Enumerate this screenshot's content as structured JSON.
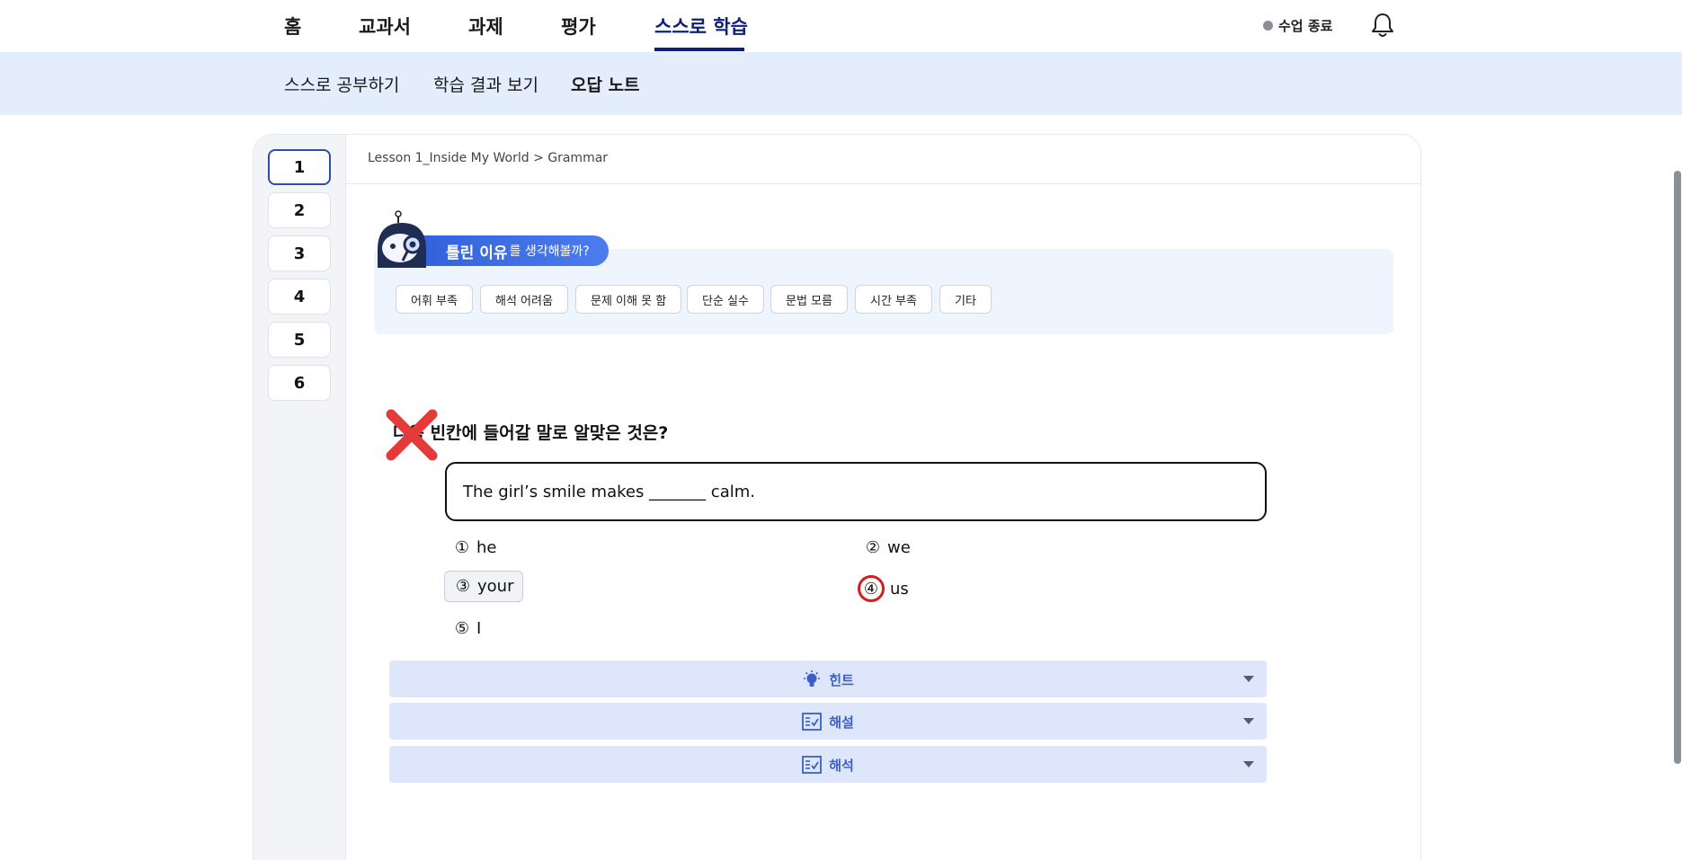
{
  "topnav": {
    "tabs": [
      {
        "label": "홈"
      },
      {
        "label": "교과서"
      },
      {
        "label": "과제"
      },
      {
        "label": "평가"
      },
      {
        "label": "스스로 학습",
        "active": true
      }
    ],
    "end_class_label": "수업 종료",
    "bell_icon": "bell-icon"
  },
  "subnav": {
    "items": [
      {
        "label": "스스로 공부하기"
      },
      {
        "label": "학습 결과 보기"
      },
      {
        "label": "오답 노트",
        "active": true
      }
    ]
  },
  "question_numbers": [
    "1",
    "2",
    "3",
    "4",
    "5",
    "6"
  ],
  "active_question": "1",
  "breadcrumb": "Lesson 1_Inside My World > Grammar",
  "wrong_reason": {
    "title": "틀린 이유",
    "title_suffix": "를 생각해볼까?",
    "chips": [
      "어휘 부족",
      "해석 어려움",
      "문제 이해 못 함",
      "단순 실수",
      "문법 모름",
      "시간 부족",
      "기타"
    ]
  },
  "question": {
    "text": "다음 빈칸에 들어갈 말로 알맞은 것은?",
    "result": "wrong",
    "sentence": "The girl’s smile makes _______ calm.",
    "options": [
      {
        "num": "①",
        "text": "he"
      },
      {
        "num": "②",
        "text": "we"
      },
      {
        "num": "③",
        "text": "your",
        "selected": true
      },
      {
        "num": "④",
        "text": "us",
        "correct": true
      },
      {
        "num": "⑤",
        "text": "I"
      }
    ]
  },
  "accordions": [
    {
      "label": "힌트",
      "icon": "lightbulb-icon"
    },
    {
      "label": "해설",
      "icon": "checklist-icon"
    },
    {
      "label": "해석",
      "icon": "checklist-icon"
    }
  ],
  "colors": {
    "accent": "#0e1e7a",
    "subnav_bg": "#e3edfc",
    "accordion_bg": "#dde6fb",
    "wrong_red": "#e53a3a",
    "correct_circle": "#d81b1b"
  }
}
